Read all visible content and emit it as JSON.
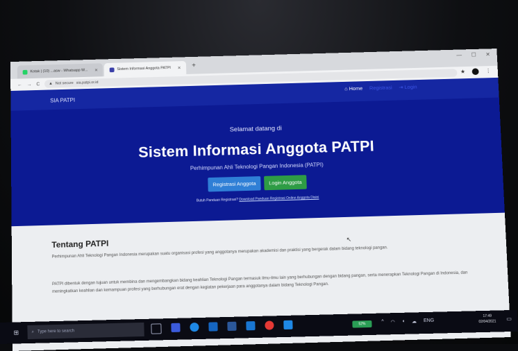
{
  "browser": {
    "tabs": [
      {
        "label": "Kotak | (10) ...asw - Whatsapp W..."
      },
      {
        "label": "Sistem Informasi Anggota PATPI"
      }
    ],
    "new_tab": "+",
    "back": "←",
    "forward": "→",
    "reload": "C",
    "security_label": "Not secure",
    "url": "sia.patpi.or.id"
  },
  "nav": {
    "brand": "SIA PATPI",
    "home": "Home",
    "register": "Registrasi",
    "login": "Login"
  },
  "hero": {
    "welcome": "Selamat datang di",
    "title": "Sistem Informasi Anggota PATPI",
    "subtitle": "Perhimpunan Ahli Teknologi Pangan Indonesia (PATPI)",
    "btn_register": "Registrasi Anggota",
    "btn_login": "Login Anggota",
    "guide_text": "Butuh Panduan Registrasi?",
    "guide_link": "Download Panduan Registrasi Online Anggota Disini"
  },
  "about": {
    "title": "Tentang PATPI",
    "p1": "Perhimpunan Ahli Teknologi Pangan Indonesia merupakan suatu organisasi profesi yang anggotanya merupakan akademisi dan praktisi yang bergerak dalam bidang teknologi pangan.",
    "p2": "PATPI dibentuk dengan tujuan untuk membina dan mengembangkan bidang keahlian Teknologi Pangan termasuk ilmu-ilmu lain yang berhubungan dengan bidang pangan, serta menerapkan Teknologi Pangan di Indonesia, dan meningkatkan keahlian dan kemampuan profesi yang berhubungan erat dengan kegiatan pekerjaan para anggotanya dalam bidang Teknologi Pangan."
  },
  "taskbar": {
    "search_placeholder": "Type here to search",
    "battery": "52%",
    "lang": "ENG",
    "time": "17:49",
    "date": "02/04/2021"
  },
  "colors": {
    "navbar": "#1527a2",
    "hero": "#0c1a93",
    "btn_register": "#2f7fd6",
    "btn_login": "#2e9c45"
  }
}
